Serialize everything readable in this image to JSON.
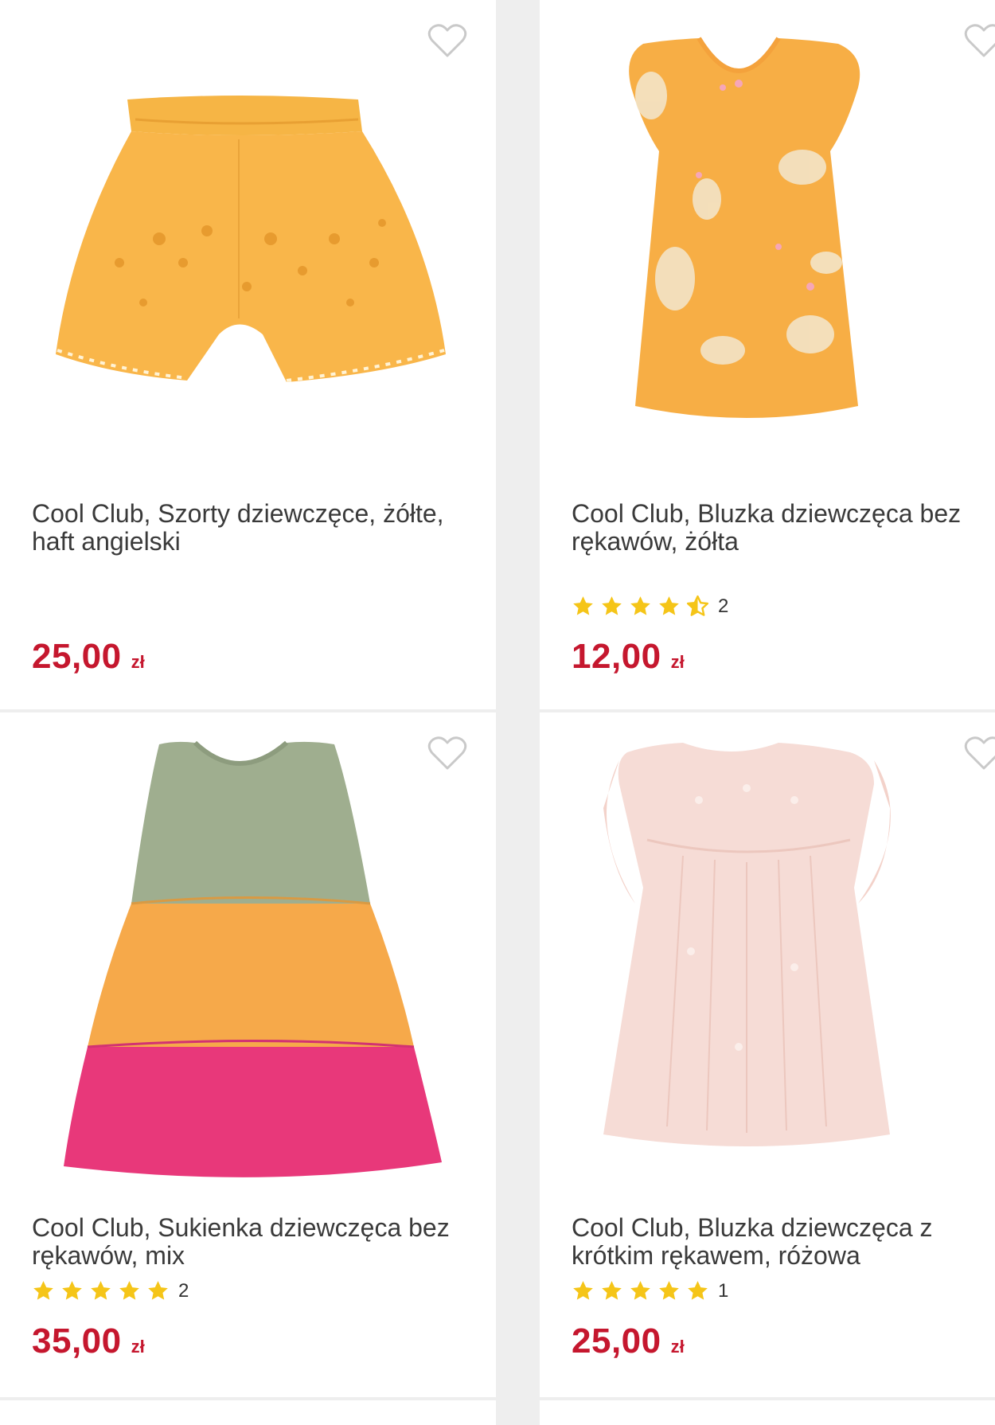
{
  "products": [
    {
      "title": "Cool Club, Szorty dziewczęce, żółte, haft angielski",
      "price": "25,00",
      "currency": "zł",
      "rating": null,
      "rating_count": null,
      "image": "yellow-shorts-image"
    },
    {
      "title": "Cool Club, Bluzka dziewczęca bez rękawów, żółta",
      "price": "12,00",
      "currency": "zł",
      "rating": 4.5,
      "rating_count": "2",
      "image": "yellow-blouse-image"
    },
    {
      "title": "Cool Club, Sukienka dziewczęca bez rękawów, mix",
      "price": "35,00",
      "currency": "zł",
      "rating": 5,
      "rating_count": "2",
      "image": "colorblock-dress-image"
    },
    {
      "title": "Cool Club, Bluzka dziewczęca z krótkim rękawem, różowa",
      "price": "25,00",
      "currency": "zł",
      "rating": 5,
      "rating_count": "1",
      "image": "pink-blouse-image"
    }
  ],
  "colors": {
    "price": "#c5172e",
    "star": "#f5c518",
    "title": "#3a3a3a",
    "divider": "#eeeeee"
  },
  "icons": {
    "favorite": "heart-outline-icon",
    "rating": "star-icon"
  }
}
